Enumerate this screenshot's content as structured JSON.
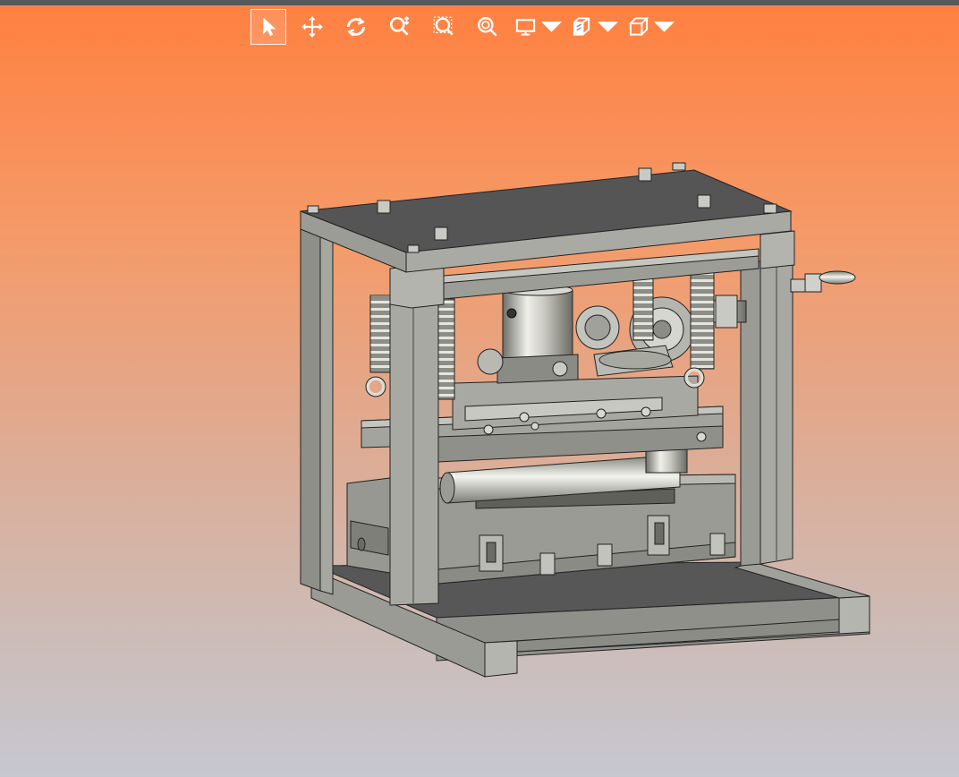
{
  "window": {
    "bar_color": "#55585c"
  },
  "background": {
    "top_color": "#ff8040",
    "bottom_color": "#c6c7d0"
  },
  "toolbar": {
    "tools": [
      {
        "id": "select",
        "icon": "cursor-arrow-icon",
        "active": true
      },
      {
        "id": "pan",
        "icon": "pan-arrows-icon",
        "active": false
      },
      {
        "id": "rotate",
        "icon": "rotate-icon",
        "active": false
      },
      {
        "id": "zoom",
        "icon": "zoom-dynamic-icon",
        "active": false
      },
      {
        "id": "zoom-window",
        "icon": "zoom-window-icon",
        "active": false
      },
      {
        "id": "zoom-fit",
        "icon": "zoom-fit-icon",
        "active": false
      },
      {
        "id": "display-mode",
        "icon": "monitor-icon",
        "dropdown": true
      },
      {
        "id": "section",
        "icon": "section-view-icon",
        "dropdown": true
      },
      {
        "id": "view-orientation",
        "icon": "cube-view-icon",
        "dropdown": true
      }
    ]
  },
  "model": {
    "name": "",
    "metal_color": "#9b9c92",
    "dark_color": "#545454"
  }
}
